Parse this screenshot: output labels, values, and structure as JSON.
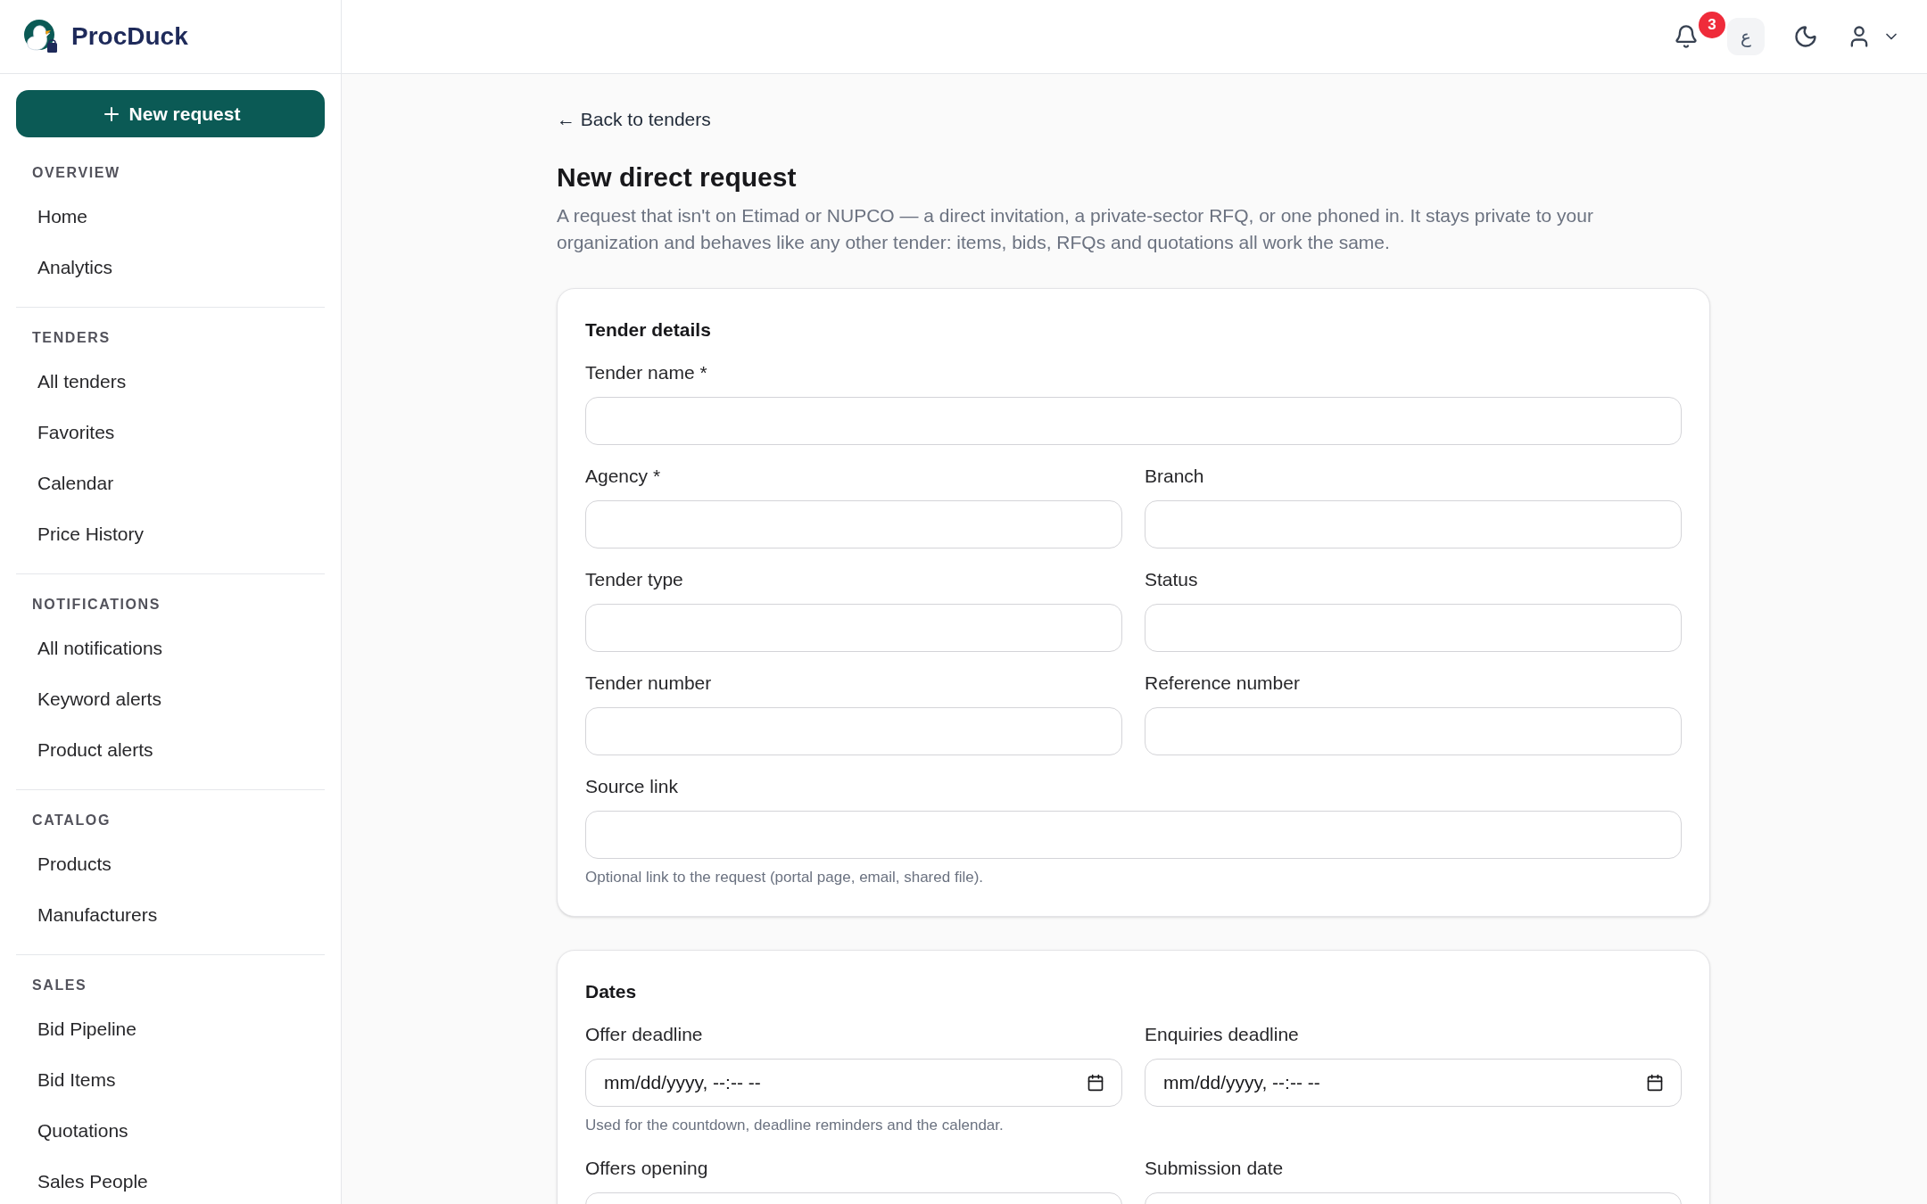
{
  "brand": "ProcDuck",
  "new_request_button": "New request",
  "sidebar": [
    {
      "heading": "OVERVIEW",
      "items": [
        {
          "label": "Home",
          "selected": false
        },
        {
          "label": "Analytics",
          "selected": false
        }
      ]
    },
    {
      "heading": "TENDERS",
      "items": [
        {
          "label": "All tenders",
          "selected": false
        },
        {
          "label": "Favorites",
          "selected": false
        },
        {
          "label": "Calendar",
          "selected": false
        },
        {
          "label": "Price History",
          "selected": false
        }
      ]
    },
    {
      "heading": "NOTIFICATIONS",
      "items": [
        {
          "label": "All notifications",
          "selected": false
        },
        {
          "label": "Keyword alerts",
          "selected": false
        },
        {
          "label": "Product alerts",
          "selected": false
        }
      ]
    },
    {
      "heading": "CATALOG",
      "items": [
        {
          "label": "Products",
          "selected": false
        },
        {
          "label": "Manufacturers",
          "selected": false
        }
      ]
    },
    {
      "heading": "SALES",
      "items": [
        {
          "label": "Bid Pipeline",
          "selected": false
        },
        {
          "label": "Bid Items",
          "selected": false
        },
        {
          "label": "Quotations",
          "selected": false
        },
        {
          "label": "Sales People",
          "selected": false
        }
      ]
    }
  ],
  "header": {
    "notification_count": "3",
    "language_button": "ع"
  },
  "back_link": "← Back to tenders",
  "title": "New direct request",
  "description": "A request that isn't on Etimad or NUPCO — a direct invitation, a private-sector RFQ, or one phoned in. It stays private to your organization and behaves like any other tender: items, bids, RFQs and quotations all work the same.",
  "sections": [
    {
      "title": "Tender details",
      "rows": [
        {
          "fields": [
            {
              "label": "Tender name *",
              "kind": "text"
            }
          ]
        },
        {
          "fields": [
            {
              "label": "Agency *",
              "kind": "text"
            },
            {
              "label": "Branch",
              "kind": "text"
            }
          ]
        },
        {
          "fields": [
            {
              "label": "Tender type",
              "kind": "text"
            },
            {
              "label": "Status",
              "kind": "text"
            }
          ]
        },
        {
          "fields": [
            {
              "label": "Tender number",
              "kind": "text"
            },
            {
              "label": "Reference number",
              "kind": "text"
            }
          ]
        },
        {
          "fields": [
            {
              "label": "Source link",
              "kind": "text",
              "hint": "Optional link to the request (portal page, email, shared file)."
            }
          ]
        }
      ]
    },
    {
      "title": "Dates",
      "rows": [
        {
          "fields": [
            {
              "label": "Offer deadline",
              "kind": "datetime",
              "placeholder": "mm/dd/yyyy, --:-- --",
              "hint": "Used for the countdown, deadline reminders and the calendar."
            },
            {
              "label": "Enquiries deadline",
              "kind": "datetime",
              "placeholder": "mm/dd/yyyy, --:-- --"
            }
          ]
        },
        {
          "fields": [
            {
              "label": "Offers opening",
              "kind": "cut"
            },
            {
              "label": "Submission date",
              "kind": "cut"
            }
          ]
        }
      ]
    }
  ]
}
